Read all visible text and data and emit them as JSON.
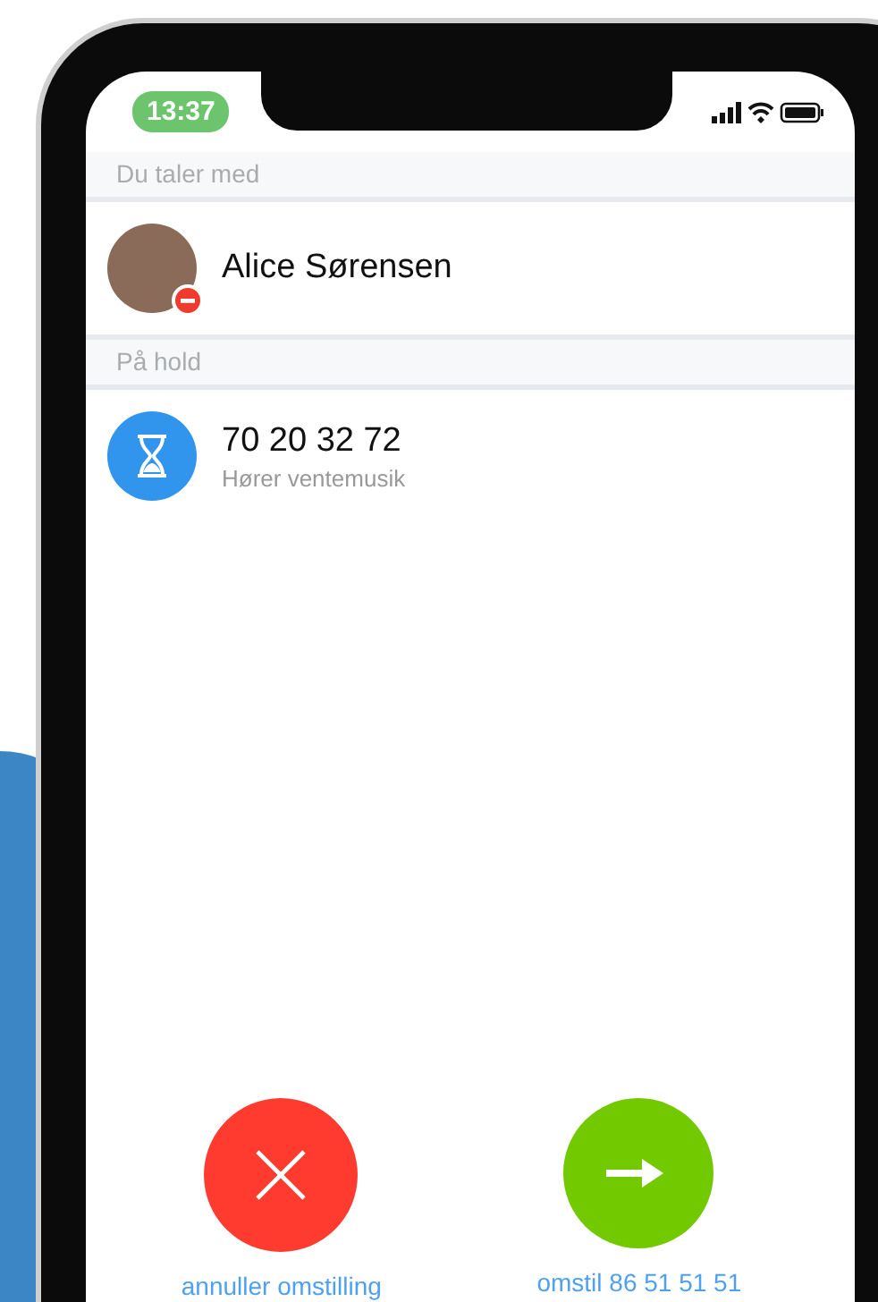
{
  "status_bar": {
    "time": "13:37"
  },
  "sections": [
    {
      "header": "Du taler med",
      "contacts": [
        {
          "kind": "photo",
          "name": "Alice Sørensen",
          "do_not_disturb": true
        }
      ]
    },
    {
      "header": "På hold",
      "contacts": [
        {
          "kind": "hourglass",
          "name": "70 20 32 72",
          "subtitle": "Hører ventemusik",
          "do_not_disturb": false
        }
      ]
    }
  ],
  "actions": [
    {
      "kind": "cancel",
      "label": "annuller omstilling"
    },
    {
      "kind": "transfer",
      "label": "omstil 86 51 51 51"
    }
  ]
}
